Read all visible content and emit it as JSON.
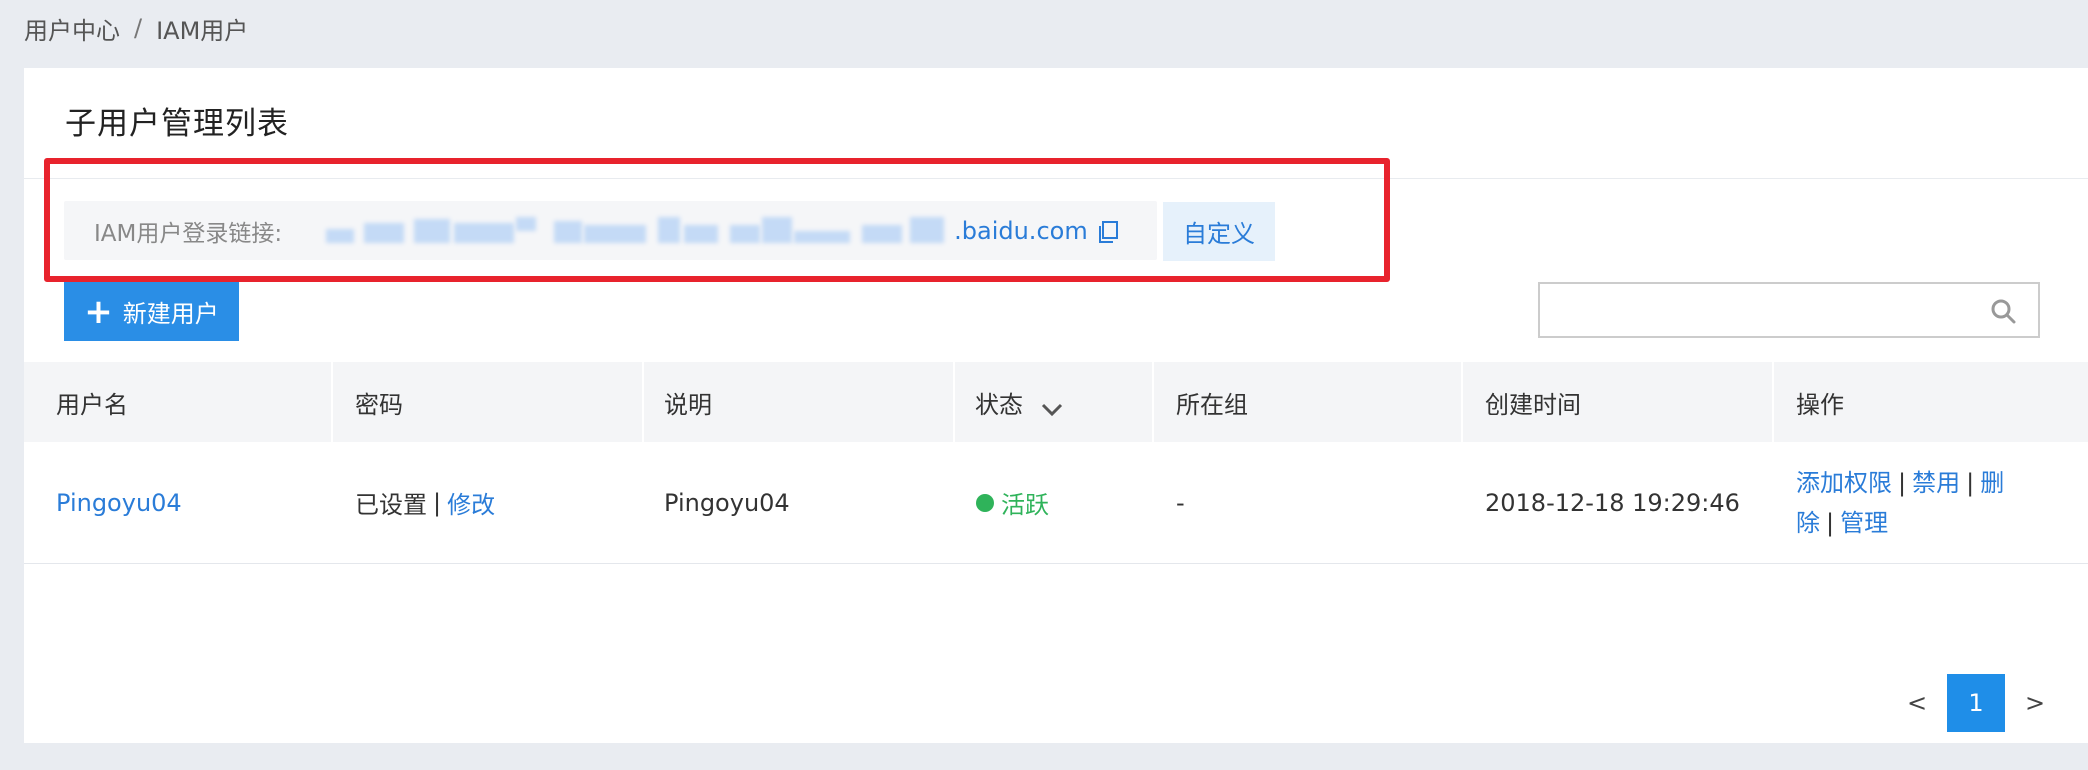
{
  "breadcrumb": {
    "items": [
      "用户中心",
      "IAM用户"
    ],
    "separator": "/"
  },
  "card": {
    "title": "子用户管理列表"
  },
  "login_link": {
    "label": "IAM用户登录链接:",
    "domain_suffix": ".baidu.com",
    "copy_icon": "copy-icon",
    "customize_label": "自定义"
  },
  "toolbar": {
    "new_user_label": "新建用户",
    "search_placeholder": "",
    "search_icon": "search-icon"
  },
  "table": {
    "columns": [
      "用户名",
      "密码",
      "说明",
      "状态",
      "所在组",
      "创建时间",
      "操作"
    ],
    "rows": [
      {
        "username": "Pingoyu04",
        "password_status": "已设置",
        "password_action": "修改",
        "description": "Pingoyu04",
        "status": "活跃",
        "group": "-",
        "created_at": "2018-12-18 19:29:46",
        "actions": [
          "添加权限",
          "禁用",
          "删除",
          "管理"
        ]
      }
    ]
  },
  "pagination": {
    "prev": "<",
    "current": "1",
    "next": ">"
  },
  "colors": {
    "primary": "#2a8ee6",
    "link": "#2a7cd8",
    "active": "#2fb35a",
    "highlight": "#e8232d"
  }
}
